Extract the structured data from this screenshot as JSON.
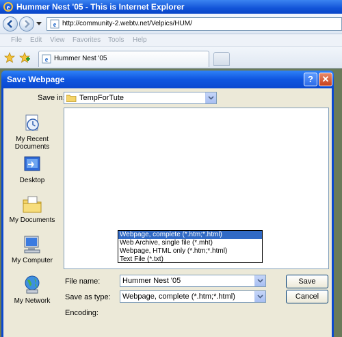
{
  "browser": {
    "title": "Hummer Nest '05 - This is Internet Explorer",
    "address": "http://community-2.webtv.net/Velpics/HUM/",
    "menu": [
      "File",
      "Edit",
      "View",
      "Favorites",
      "Tools",
      "Help"
    ],
    "tab_label": "Hummer Nest '05"
  },
  "dialog": {
    "title": "Save Webpage",
    "save_in_label": "Save in:",
    "save_in_value": "TempForTute",
    "places": [
      {
        "label": "My Recent Documents",
        "icon": "recent-documents-icon"
      },
      {
        "label": "Desktop",
        "icon": "desktop-icon"
      },
      {
        "label": "My Documents",
        "icon": "my-documents-icon"
      },
      {
        "label": "My Computer",
        "icon": "my-computer-icon"
      },
      {
        "label": "My Network",
        "icon": "my-network-icon"
      }
    ],
    "file_name_label": "File name:",
    "file_name_value": "Hummer Nest '05",
    "save_as_label": "Save as type:",
    "save_as_value": "Webpage, complete (*.htm;*.html)",
    "encoding_label": "Encoding:",
    "save_button": "Save",
    "cancel_button": "Cancel",
    "type_options": [
      "Webpage, complete (*.htm;*.html)",
      "Web Archive, single file (*.mht)",
      "Webpage, HTML only (*.htm;*.html)",
      "Text File (*.txt)"
    ],
    "selected_option_index": 0
  },
  "colors": {
    "titlebar": "#0a48d0",
    "dialog_face": "#ece9d8",
    "selection": "#316ac5"
  }
}
